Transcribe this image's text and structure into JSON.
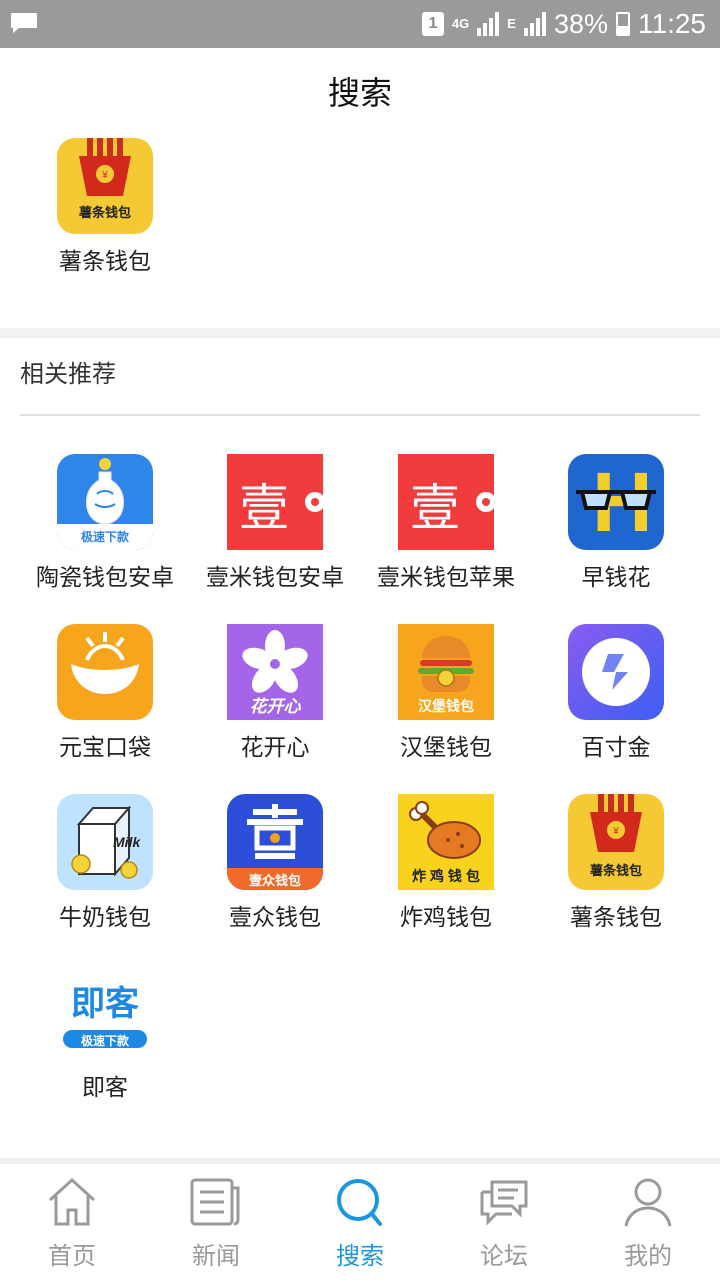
{
  "status_bar": {
    "sim": "1",
    "network": "4G",
    "network2": "E",
    "battery": "38%",
    "time": "11:25"
  },
  "header": {
    "title": "搜索"
  },
  "result": {
    "app": {
      "name": "薯条钱包",
      "icon": "fries-wallet-icon",
      "icon_text": "薯条钱包"
    }
  },
  "recommend": {
    "title": "相关推荐",
    "apps": [
      {
        "name": "陶瓷钱包安卓",
        "icon": "porcelain-vase-icon",
        "icon_text": "极速下款"
      },
      {
        "name": "壹米钱包安卓",
        "icon": "yimi-icon",
        "icon_text": "壹"
      },
      {
        "name": "壹米钱包苹果",
        "icon": "yimi-icon",
        "icon_text": "壹"
      },
      {
        "name": "早钱花",
        "icon": "glasses-h-icon",
        "icon_text": "H"
      },
      {
        "name": "元宝口袋",
        "icon": "ingot-icon",
        "icon_text": ""
      },
      {
        "name": "花开心",
        "icon": "flower-icon",
        "icon_text": "花开心"
      },
      {
        "name": "汉堡钱包",
        "icon": "burger-icon",
        "icon_text": "汉堡钱包"
      },
      {
        "name": "百寸金",
        "icon": "diamond-ring-icon",
        "icon_text": ""
      },
      {
        "name": "牛奶钱包",
        "icon": "milk-carton-icon",
        "icon_text": "Milk"
      },
      {
        "name": "壹众钱包",
        "icon": "yizhong-icon",
        "icon_text": "壹众钱包"
      },
      {
        "name": "炸鸡钱包",
        "icon": "fried-chicken-icon",
        "icon_text": "炸 鸡 钱 包"
      },
      {
        "name": "薯条钱包",
        "icon": "fries-wallet-icon",
        "icon_text": "薯条钱包"
      },
      {
        "name": "即客",
        "icon": "jike-icon",
        "icon_text": "即客",
        "icon_text2": "极速下款"
      }
    ]
  },
  "tabs": [
    {
      "label": "首页",
      "icon": "home-icon",
      "active": false
    },
    {
      "label": "新闻",
      "icon": "news-icon",
      "active": false
    },
    {
      "label": "搜索",
      "icon": "search-icon",
      "active": true
    },
    {
      "label": "论坛",
      "icon": "forum-icon",
      "active": false
    },
    {
      "label": "我的",
      "icon": "user-icon",
      "active": false
    }
  ],
  "colors": {
    "accent": "#1a97e0",
    "status_bar": "#9a9a9a",
    "inactive": "#9a9a9a"
  }
}
